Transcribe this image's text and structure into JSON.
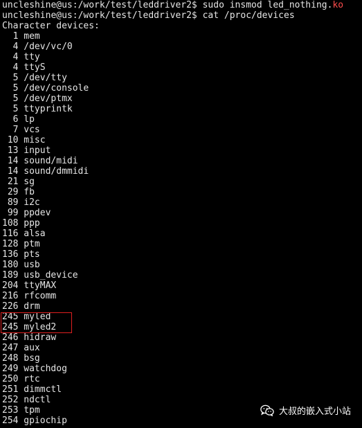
{
  "terminal": {
    "cmd1": {
      "prompt": "uncleshine@us:/work/test/leddriver2$ ",
      "command": "sudo insmod led_nothing.",
      "ext": "ko"
    },
    "cmd2": {
      "prompt": "uncleshine@us:/work/test/leddriver2$ ",
      "command": "cat /proc/devices"
    },
    "header": "Character devices:",
    "devices": [
      {
        "num": "1",
        "name": "mem"
      },
      {
        "num": "4",
        "name": "/dev/vc/0"
      },
      {
        "num": "4",
        "name": "tty"
      },
      {
        "num": "4",
        "name": "ttyS"
      },
      {
        "num": "5",
        "name": "/dev/tty"
      },
      {
        "num": "5",
        "name": "/dev/console"
      },
      {
        "num": "5",
        "name": "/dev/ptmx"
      },
      {
        "num": "5",
        "name": "ttyprintk"
      },
      {
        "num": "6",
        "name": "lp"
      },
      {
        "num": "7",
        "name": "vcs"
      },
      {
        "num": "10",
        "name": "misc"
      },
      {
        "num": "13",
        "name": "input"
      },
      {
        "num": "14",
        "name": "sound/midi"
      },
      {
        "num": "14",
        "name": "sound/dmmidi"
      },
      {
        "num": "21",
        "name": "sg"
      },
      {
        "num": "29",
        "name": "fb"
      },
      {
        "num": "89",
        "name": "i2c"
      },
      {
        "num": "99",
        "name": "ppdev"
      },
      {
        "num": "108",
        "name": "ppp"
      },
      {
        "num": "116",
        "name": "alsa"
      },
      {
        "num": "128",
        "name": "ptm"
      },
      {
        "num": "136",
        "name": "pts"
      },
      {
        "num": "180",
        "name": "usb"
      },
      {
        "num": "189",
        "name": "usb_device"
      },
      {
        "num": "204",
        "name": "ttyMAX"
      },
      {
        "num": "216",
        "name": "rfcomm"
      },
      {
        "num": "226",
        "name": "drm"
      },
      {
        "num": "245",
        "name": "myled"
      },
      {
        "num": "245",
        "name": "myled2"
      },
      {
        "num": "246",
        "name": "hidraw"
      },
      {
        "num": "247",
        "name": "aux"
      },
      {
        "num": "248",
        "name": "bsg"
      },
      {
        "num": "249",
        "name": "watchdog"
      },
      {
        "num": "250",
        "name": "rtc"
      },
      {
        "num": "251",
        "name": "dimmctl"
      },
      {
        "num": "252",
        "name": "ndctl"
      },
      {
        "num": "253",
        "name": "tpm"
      },
      {
        "num": "254",
        "name": "gpiochip"
      }
    ]
  },
  "watermark": {
    "text": "大叔的嵌入式小站",
    "icon": "wechat-icon"
  },
  "colors": {
    "background": "#000000",
    "text": "#e6e6e6",
    "ko_extension": "#ff4d4d",
    "highlight_box": "#e02020"
  }
}
